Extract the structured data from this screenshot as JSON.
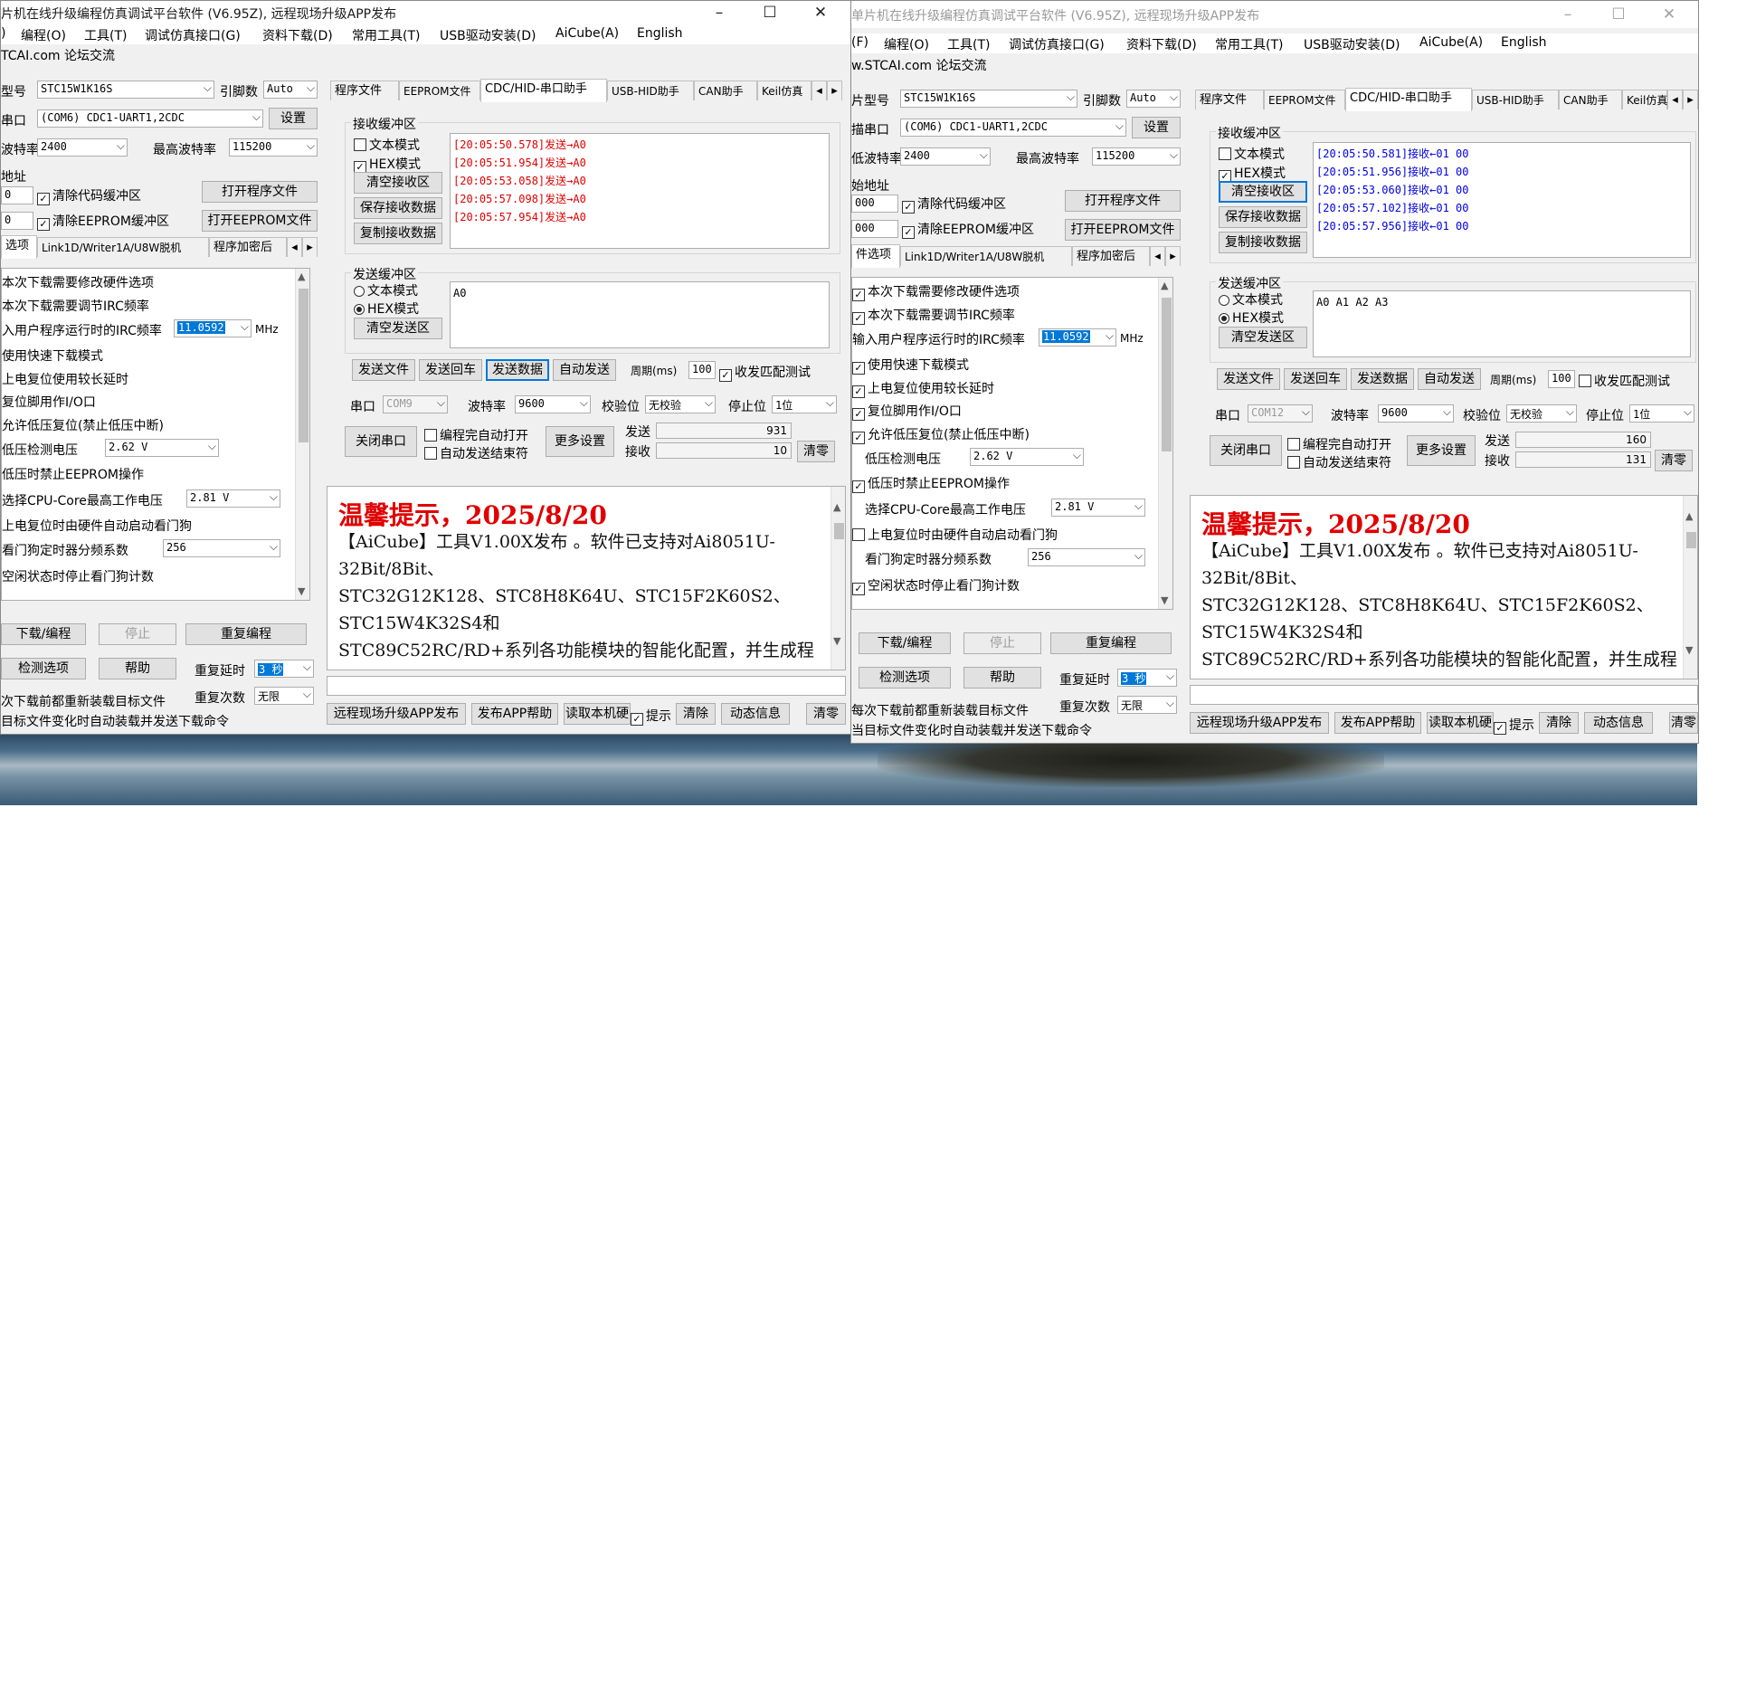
{
  "left": {
    "title": "片机在线升级编程仿真调试平台软件 (V6.95Z), 远程现场升级APP发布",
    "menus": [
      ")",
      "编程(O)",
      "工具(T)",
      "调试仿真接口(G)",
      "资料下载(D)",
      "常用工具(T)",
      "USB驱动安装(D)",
      "AiCube(A)",
      "English"
    ],
    "subtitle": "TCAI.com 论坛交流",
    "mcu_label": "型号",
    "mcu_value": "STC15W1K16S",
    "pins_label": "引脚数",
    "pins_value": "Auto",
    "port_label": "串口",
    "port_value": "(COM6) CDC1-UART1,2CDC",
    "settings_btn": "设置",
    "baud_label": "波特率",
    "baud_value": "2400",
    "maxbaud_label": "最高波特率",
    "maxbaud_value": "115200",
    "addr_label": "地址",
    "addr1": "0",
    "addr2": "0",
    "clear_code": "清除代码缓冲区",
    "clear_eeprom": "清除EEPROM缓冲区",
    "open_prog": "打开程序文件",
    "open_eeprom": "打开EEPROM文件",
    "tabs_left": [
      "选项",
      "Link1D/Writer1A/U8W脱机",
      "程序加密后"
    ],
    "options": [
      "本次下载需要修改硬件选项",
      "本次下载需要调节IRC频率",
      "入用户程序运行时的IRC频率",
      "使用快速下载模式",
      "上电复位使用较长延时",
      "复位脚用作I/O口",
      "允许低压复位(禁止低压中断)",
      "低压检测电压",
      "低压时禁止EEPROM操作",
      "选择CPU-Core最高工作电压",
      "上电复位时由硬件自动启动看门狗",
      "看门狗定时器分频系数",
      "空闲状态时停止看门狗计数"
    ],
    "irc_value": "11.0592",
    "irc_unit": "MHz",
    "lv_value": "2.62 V",
    "cpu_v_value": "2.81 V",
    "wdt_value": "256",
    "download_btn": "下载/编程",
    "stop_btn": "停止",
    "reprog_btn": "重复编程",
    "check_btn": "检测选项",
    "help_btn": "帮助",
    "delay_label": "重复延时",
    "delay_value": "3 秒",
    "count_label": "重复次数",
    "count_value": "无限",
    "reload1": "次下载前都重新装载目标文件",
    "reload2": "目标文件变化时自动装载并发送下载命令",
    "tabs_right": [
      "程序文件",
      "EEPROM文件",
      "CDC/HID-串口助手",
      "USB-HID助手",
      "CAN助手",
      "Keil仿真"
    ],
    "recv_group": "接收缓冲区",
    "text_mode": "文本模式",
    "hex_mode": "HEX模式",
    "clear_recv": "清空接收区",
    "save_recv": "保存接收数据",
    "copy_recv": "复制接收数据",
    "recv_lines": [
      "[20:05:50.578]发送→A0",
      "[20:05:51.954]发送→A0",
      "[20:05:53.058]发送→A0",
      "[20:05:57.098]发送→A0",
      "[20:05:57.954]发送→A0"
    ],
    "send_group": "发送缓冲区",
    "clear_send": "清空发送区",
    "send_text": "A0",
    "send_file": "发送文件",
    "send_enter": "发送回车",
    "send_data": "发送数据",
    "auto_send": "自动发送",
    "period_label": "周期(ms)",
    "period_value": "100",
    "match_test": "收发匹配测试",
    "com_label": "串口",
    "com_value": "COM9",
    "baud2_label": "波特率",
    "baud2_value": "9600",
    "parity_label": "校验位",
    "parity_value": "无校验",
    "stop_label": "停止位",
    "stop_value": "1位",
    "close_port": "关闭串口",
    "auto_open": "编程完自动打开",
    "auto_end": "自动发送结束符",
    "more_settings": "更多设置",
    "tx_label": "发送",
    "tx_value": "931",
    "rx_label": "接收",
    "rx_value": "10",
    "clear_count": "清零",
    "notice_title": "温馨提示，2025/8/20",
    "notice_lines": [
      "【AiCube】工具V1.00X发布 。软件已支持对Ai8051U-",
      "32Bit/8Bit、",
      "STC32G12K128、STC8H8K64U、STC15F2K60S2、",
      "STC15W4K32S4和",
      "STC89C52RC/RD+系列各功能模块的智能化配置，并生成程"
    ],
    "bottom_btns": [
      "远程现场升级APP发布",
      "发布APP帮助",
      "读取本机硬",
      "提示",
      "清除",
      "动态信息",
      "清零"
    ]
  },
  "right": {
    "title": "单片机在线升级编程仿真调试平台软件 (V6.95Z), 远程现场升级APP发布",
    "menus": [
      "(F)",
      "编程(O)",
      "工具(T)",
      "调试仿真接口(G)",
      "资料下载(D)",
      "常用工具(T)",
      "USB驱动安装(D)",
      "AiCube(A)",
      "English"
    ],
    "subtitle": "w.STCAI.com 论坛交流",
    "mcu_label": "片型号",
    "mcu_value": "STC15W1K16S",
    "pins_label": "引脚数",
    "pins_value": "Auto",
    "port_label": "描串口",
    "port_value": "(COM6) CDC1-UART1,2CDC",
    "settings_btn": "设置",
    "baud_label": "低波特率",
    "baud_value": "2400",
    "maxbaud_label": "最高波特率",
    "maxbaud_value": "115200",
    "addr_label": "始地址",
    "addr1": "000",
    "addr2": "000",
    "clear_code": "清除代码缓冲区",
    "clear_eeprom": "清除EEPROM缓冲区",
    "open_prog": "打开程序文件",
    "open_eeprom": "打开EEPROM文件",
    "tabs_left": [
      "件选项",
      "Link1D/Writer1A/U8W脱机",
      "程序加密后"
    ],
    "options": [
      "本次下载需要修改硬件选项",
      "本次下载需要调节IRC频率",
      "输入用户程序运行时的IRC频率",
      "使用快速下载模式",
      "上电复位使用较长延时",
      "复位脚用作I/O口",
      "允许低压复位(禁止低压中断)",
      "低压检测电压",
      "低压时禁止EEPROM操作",
      "选择CPU-Core最高工作电压",
      "上电复位时由硬件自动启动看门狗",
      "看门狗定时器分频系数",
      "空闲状态时停止看门狗计数"
    ],
    "irc_value": "11.0592",
    "irc_unit": "MHz",
    "lv_value": "2.62 V",
    "cpu_v_value": "2.81 V",
    "wdt_value": "256",
    "download_btn": "下载/编程",
    "stop_btn": "停止",
    "reprog_btn": "重复编程",
    "check_btn": "检测选项",
    "help_btn": "帮助",
    "delay_label": "重复延时",
    "delay_value": "3 秒",
    "count_label": "重复次数",
    "count_value": "无限",
    "reload1": "每次下载前都重新装载目标文件",
    "reload2": "当目标文件变化时自动装载并发送下载命令",
    "tabs_right": [
      "程序文件",
      "EEPROM文件",
      "CDC/HID-串口助手",
      "USB-HID助手",
      "CAN助手",
      "Keil仿真"
    ],
    "recv_group": "接收缓冲区",
    "text_mode": "文本模式",
    "hex_mode": "HEX模式",
    "clear_recv": "清空接收区",
    "save_recv": "保存接收数据",
    "copy_recv": "复制接收数据",
    "recv_lines": [
      "[20:05:50.581]接收←01 00",
      "[20:05:51.956]接收←01 00",
      "[20:05:53.060]接收←01 00",
      "[20:05:57.102]接收←01 00",
      "[20:05:57.956]接收←01 00"
    ],
    "send_group": "发送缓冲区",
    "clear_send": "清空发送区",
    "send_text": "A0 A1 A2 A3",
    "send_file": "发送文件",
    "send_enter": "发送回车",
    "send_data": "发送数据",
    "auto_send": "自动发送",
    "period_label": "周期(ms)",
    "period_value": "100",
    "match_test": "收发匹配测试",
    "com_label": "串口",
    "com_value": "COM12",
    "baud2_label": "波特率",
    "baud2_value": "9600",
    "parity_label": "校验位",
    "parity_value": "无校验",
    "stop_label": "停止位",
    "stop_value": "1位",
    "close_port": "关闭串口",
    "auto_open": "编程完自动打开",
    "auto_end": "自动发送结束符",
    "more_settings": "更多设置",
    "tx_label": "发送",
    "tx_value": "160",
    "rx_label": "接收",
    "rx_value": "131",
    "clear_count": "清零",
    "notice_title": "温馨提示，2025/8/20",
    "notice_lines": [
      "【AiCube】工具V1.00X发布 。软件已支持对Ai8051U-",
      "32Bit/8Bit、",
      "STC32G12K128、STC8H8K64U、STC15F2K60S2、",
      "STC15W4K32S4和",
      "STC89C52RC/RD+系列各功能模块的智能化配置，并生成程"
    ],
    "bottom_btns": [
      "远程现场升级APP发布",
      "发布APP帮助",
      "读取本机硬",
      "提示",
      "清除",
      "动态信息",
      "清零"
    ]
  }
}
